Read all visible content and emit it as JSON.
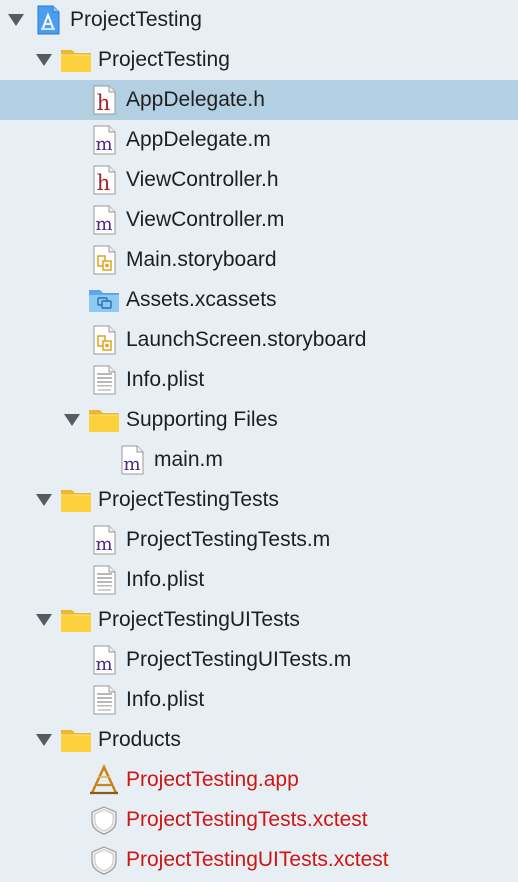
{
  "navigator": {
    "project": {
      "label": "ProjectTesting",
      "icon": "xcode-project-icon",
      "expanded": true
    },
    "groups": [
      {
        "label": "ProjectTesting",
        "icon": "folder-icon",
        "expanded": true,
        "items": [
          {
            "label": "AppDelegate.h",
            "icon": "header-file-icon",
            "selected": true
          },
          {
            "label": "AppDelegate.m",
            "icon": "objc-source-file-icon"
          },
          {
            "label": "ViewController.h",
            "icon": "header-file-icon"
          },
          {
            "label": "ViewController.m",
            "icon": "objc-source-file-icon"
          },
          {
            "label": "Main.storyboard",
            "icon": "storyboard-file-icon"
          },
          {
            "label": "Assets.xcassets",
            "icon": "asset-catalog-folder-icon"
          },
          {
            "label": "LaunchScreen.storyboard",
            "icon": "storyboard-file-icon"
          },
          {
            "label": "Info.plist",
            "icon": "plist-file-icon"
          }
        ],
        "subgroups": [
          {
            "label": "Supporting Files",
            "icon": "folder-icon",
            "expanded": true,
            "items": [
              {
                "label": "main.m",
                "icon": "objc-source-file-icon"
              }
            ]
          }
        ]
      },
      {
        "label": "ProjectTestingTests",
        "icon": "folder-icon",
        "expanded": true,
        "items": [
          {
            "label": "ProjectTestingTests.m",
            "icon": "objc-source-file-icon"
          },
          {
            "label": "Info.plist",
            "icon": "plist-file-icon"
          }
        ]
      },
      {
        "label": "ProjectTestingUITests",
        "icon": "folder-icon",
        "expanded": true,
        "items": [
          {
            "label": "ProjectTestingUITests.m",
            "icon": "objc-source-file-icon"
          },
          {
            "label": "Info.plist",
            "icon": "plist-file-icon"
          }
        ]
      },
      {
        "label": "Products",
        "icon": "folder-icon",
        "expanded": true,
        "items": [
          {
            "label": "ProjectTesting.app",
            "icon": "app-product-icon",
            "missing": true
          },
          {
            "label": "ProjectTestingTests.xctest",
            "icon": "xctest-bundle-icon",
            "missing": true
          },
          {
            "label": "ProjectTestingUITests.xctest",
            "icon": "xctest-bundle-icon",
            "missing": true
          }
        ]
      }
    ]
  },
  "colors": {
    "background": "#e7eef4",
    "selection": "#b3cfe2",
    "text": "#1f1f1f",
    "missing_product_text": "#cf1614",
    "folder": "#fdd13b",
    "header_letter": "#a3262a",
    "source_letter": "#4b2a86"
  }
}
